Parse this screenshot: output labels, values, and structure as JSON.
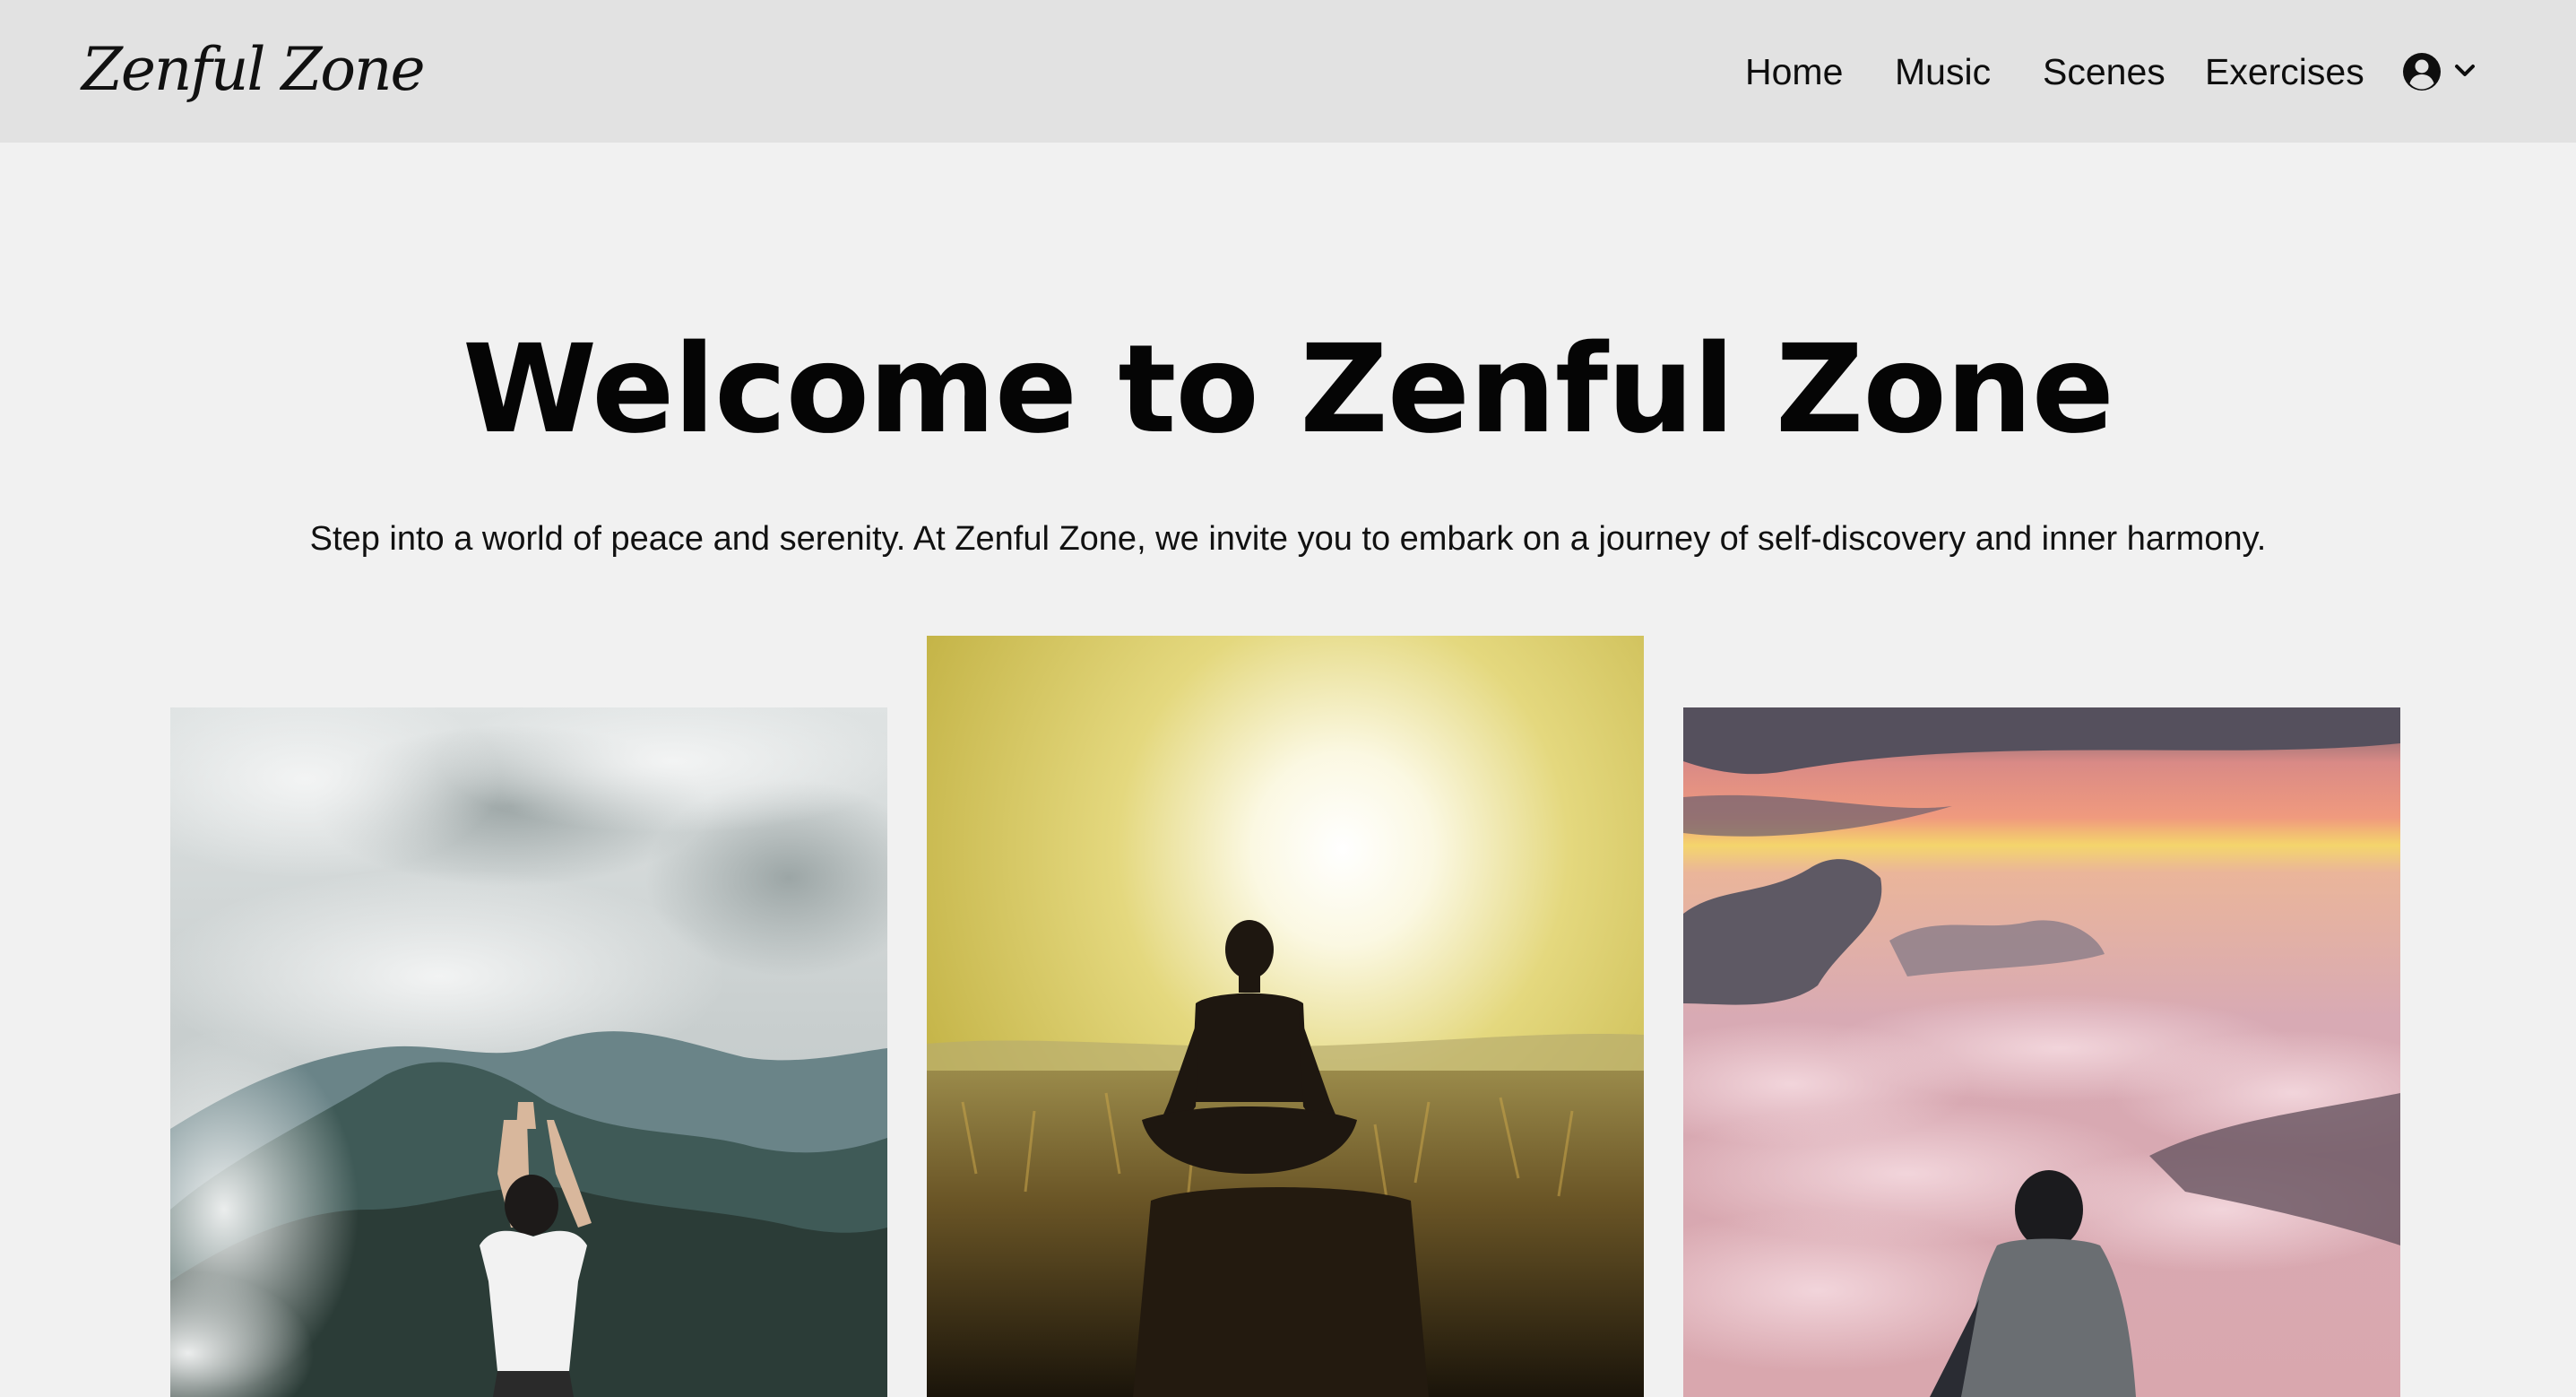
{
  "header": {
    "brand": "Zenful Zone",
    "nav": {
      "home": "Home",
      "music": "Music",
      "scenes": "Scenes",
      "exercises": "Exercises"
    },
    "user_menu_icon": "user-circle-icon",
    "dropdown_icon": "chevron-down-icon"
  },
  "hero": {
    "title": "Welcome to Zenful Zone",
    "subtitle": "Step into a world of peace and serenity. At Zenful Zone, we invite you to embark on a journey of self-discovery and inner harmony."
  },
  "gallery": {
    "images": [
      "woman doing yoga pose on misty mountain",
      "man meditating at sunset in grass field",
      "person sitting above pink clouds at dawn"
    ]
  },
  "colors": {
    "header_bg": "#e2e2e2",
    "page_bg": "#f1f1f1",
    "text": "#0b0b0b"
  }
}
